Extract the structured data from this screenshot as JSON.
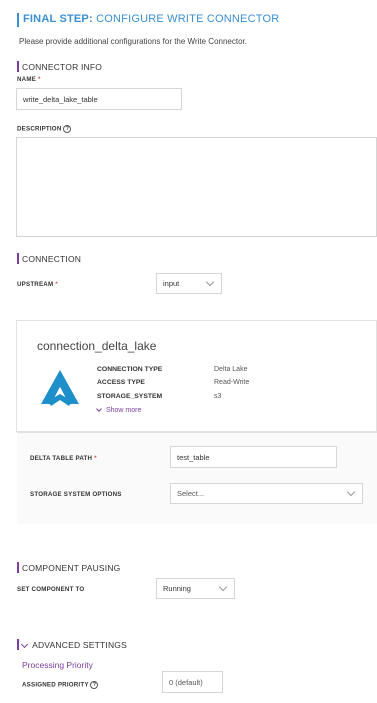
{
  "header": {
    "title_bold": "FINAL STEP:",
    "title_rest": "CONFIGURE WRITE CONNECTOR",
    "subtitle": "Please provide additional configurations for the Write Connector."
  },
  "connector_info": {
    "section_title": "CONNECTOR INFO",
    "name_label": "NAME",
    "required_mark": "*",
    "name_value": "write_delta_lake_table",
    "description_label": "DESCRIPTION",
    "description_value": ""
  },
  "connection": {
    "section_title": "CONNECTION",
    "upstream_label": "UPSTREAM",
    "upstream_value": "input",
    "card": {
      "name": "connection_delta_lake",
      "type_label": "CONNECTION TYPE",
      "type_value": "Delta Lake",
      "access_label": "ACCESS TYPE",
      "access_value": "Read-Write",
      "storage_label": "STORAGE_SYSTEM",
      "storage_value": "s3",
      "show_more": "Show more"
    },
    "delta_path_label": "DELTA TABLE PATH",
    "delta_path_value": "test_table",
    "storage_options_label": "STORAGE SYSTEM OPTIONS",
    "storage_options_placeholder": "Select..."
  },
  "pausing": {
    "section_title": "COMPONENT PAUSING",
    "set_label": "SET COMPONENT TO",
    "set_value": "Running"
  },
  "advanced": {
    "section_title": "ADVANCED SETTINGS",
    "processing_priority": "Processing Priority",
    "assigned_label": "ASSIGNED PRIORITY",
    "assigned_value": "0 (default)"
  },
  "colors": {
    "accent_purple": "#7a3e9d",
    "title_blue": "#3a8fd0",
    "delta_logo": "#1f8fc9",
    "required_red": "#d9534f"
  }
}
